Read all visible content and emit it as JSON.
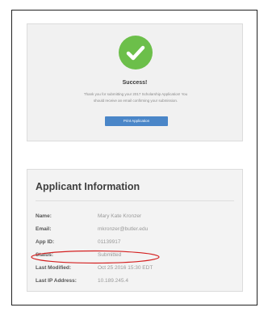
{
  "success": {
    "icon": "check-icon",
    "icon_color": "#6cbf4a",
    "title": "Success!",
    "message_line1": "Thank you for submitting your 2017 Scholarship Application! You",
    "message_line2": "should receive an email confirming your submission.",
    "print_button_label": "Print Application",
    "button_color": "#4a86c8"
  },
  "applicant": {
    "title": "Applicant Information",
    "fields": [
      {
        "label": "Name:",
        "value": "Mary Kate Kronzer"
      },
      {
        "label": "Email:",
        "value": "mkronzer@butler.edu"
      },
      {
        "label": "App ID:",
        "value": "01139917"
      },
      {
        "label": "Status:",
        "value": "Submitted"
      },
      {
        "label": "Last Modified:",
        "value": "Oct 25 2016 15:30 EDT"
      },
      {
        "label": "Last IP Address:",
        "value": "10.189.245.4"
      }
    ]
  },
  "annotation": {
    "ellipse_color": "#d42020"
  }
}
